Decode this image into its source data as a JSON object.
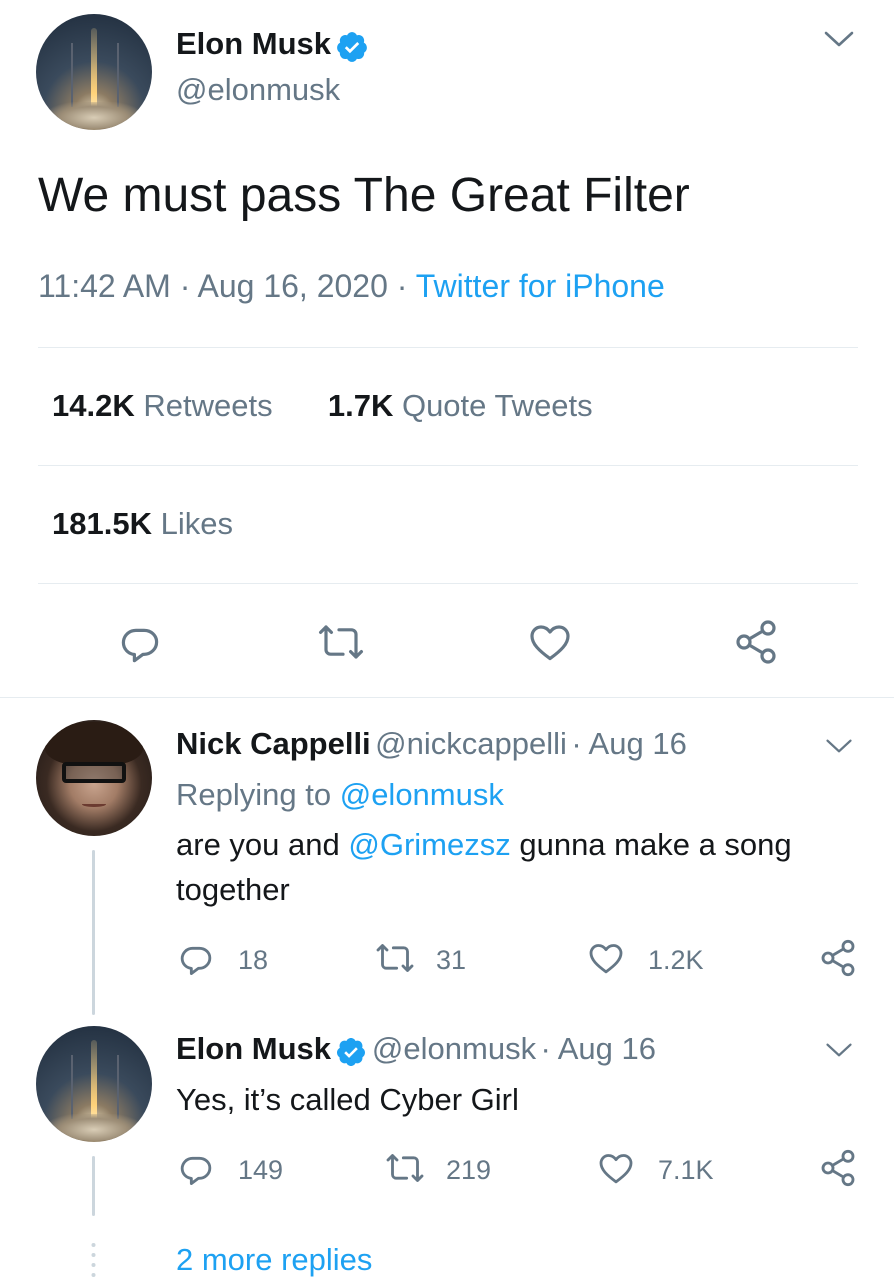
{
  "main_tweet": {
    "author_name": "Elon Musk",
    "author_handle": "@elonmusk",
    "text": "We must pass The Great Filter",
    "time": "11:42 AM",
    "date": "Aug 16, 2020",
    "separator": "·",
    "source": "Twitter for iPhone",
    "retweets_count": "14.2K",
    "retweets_label": "Retweets",
    "quotes_count": "1.7K",
    "quotes_label": "Quote Tweets",
    "likes_count": "181.5K",
    "likes_label": "Likes"
  },
  "replies": [
    {
      "author_name": "Nick Cappelli",
      "author_handle": "@nickcappelli",
      "date": "· Aug 16",
      "replying_prefix": "Replying to",
      "replying_handle": "@elonmusk",
      "text_before": "are you and",
      "mention": "@Grimezsz",
      "text_after": "gunna make a song",
      "text_line2": "together",
      "reply_count": "18",
      "retweet_count": "31",
      "like_count": "1.2K"
    },
    {
      "author_name": "Elon Musk",
      "author_handle": "@elonmusk",
      "date": "· Aug 16",
      "text": "Yes, it’s called Cyber Girl",
      "reply_count": "149",
      "retweet_count": "219",
      "like_count": "7.1K"
    }
  ],
  "more_replies": "2 more replies",
  "colors": {
    "accent": "#1da1f2",
    "secondary_text": "#657786",
    "divider": "#e6ecf0",
    "thread_line": "#ccd6dd"
  },
  "icons": [
    "verified-badge-icon",
    "chevron-down-icon",
    "reply-icon",
    "retweet-icon",
    "like-icon",
    "share-icon"
  ]
}
